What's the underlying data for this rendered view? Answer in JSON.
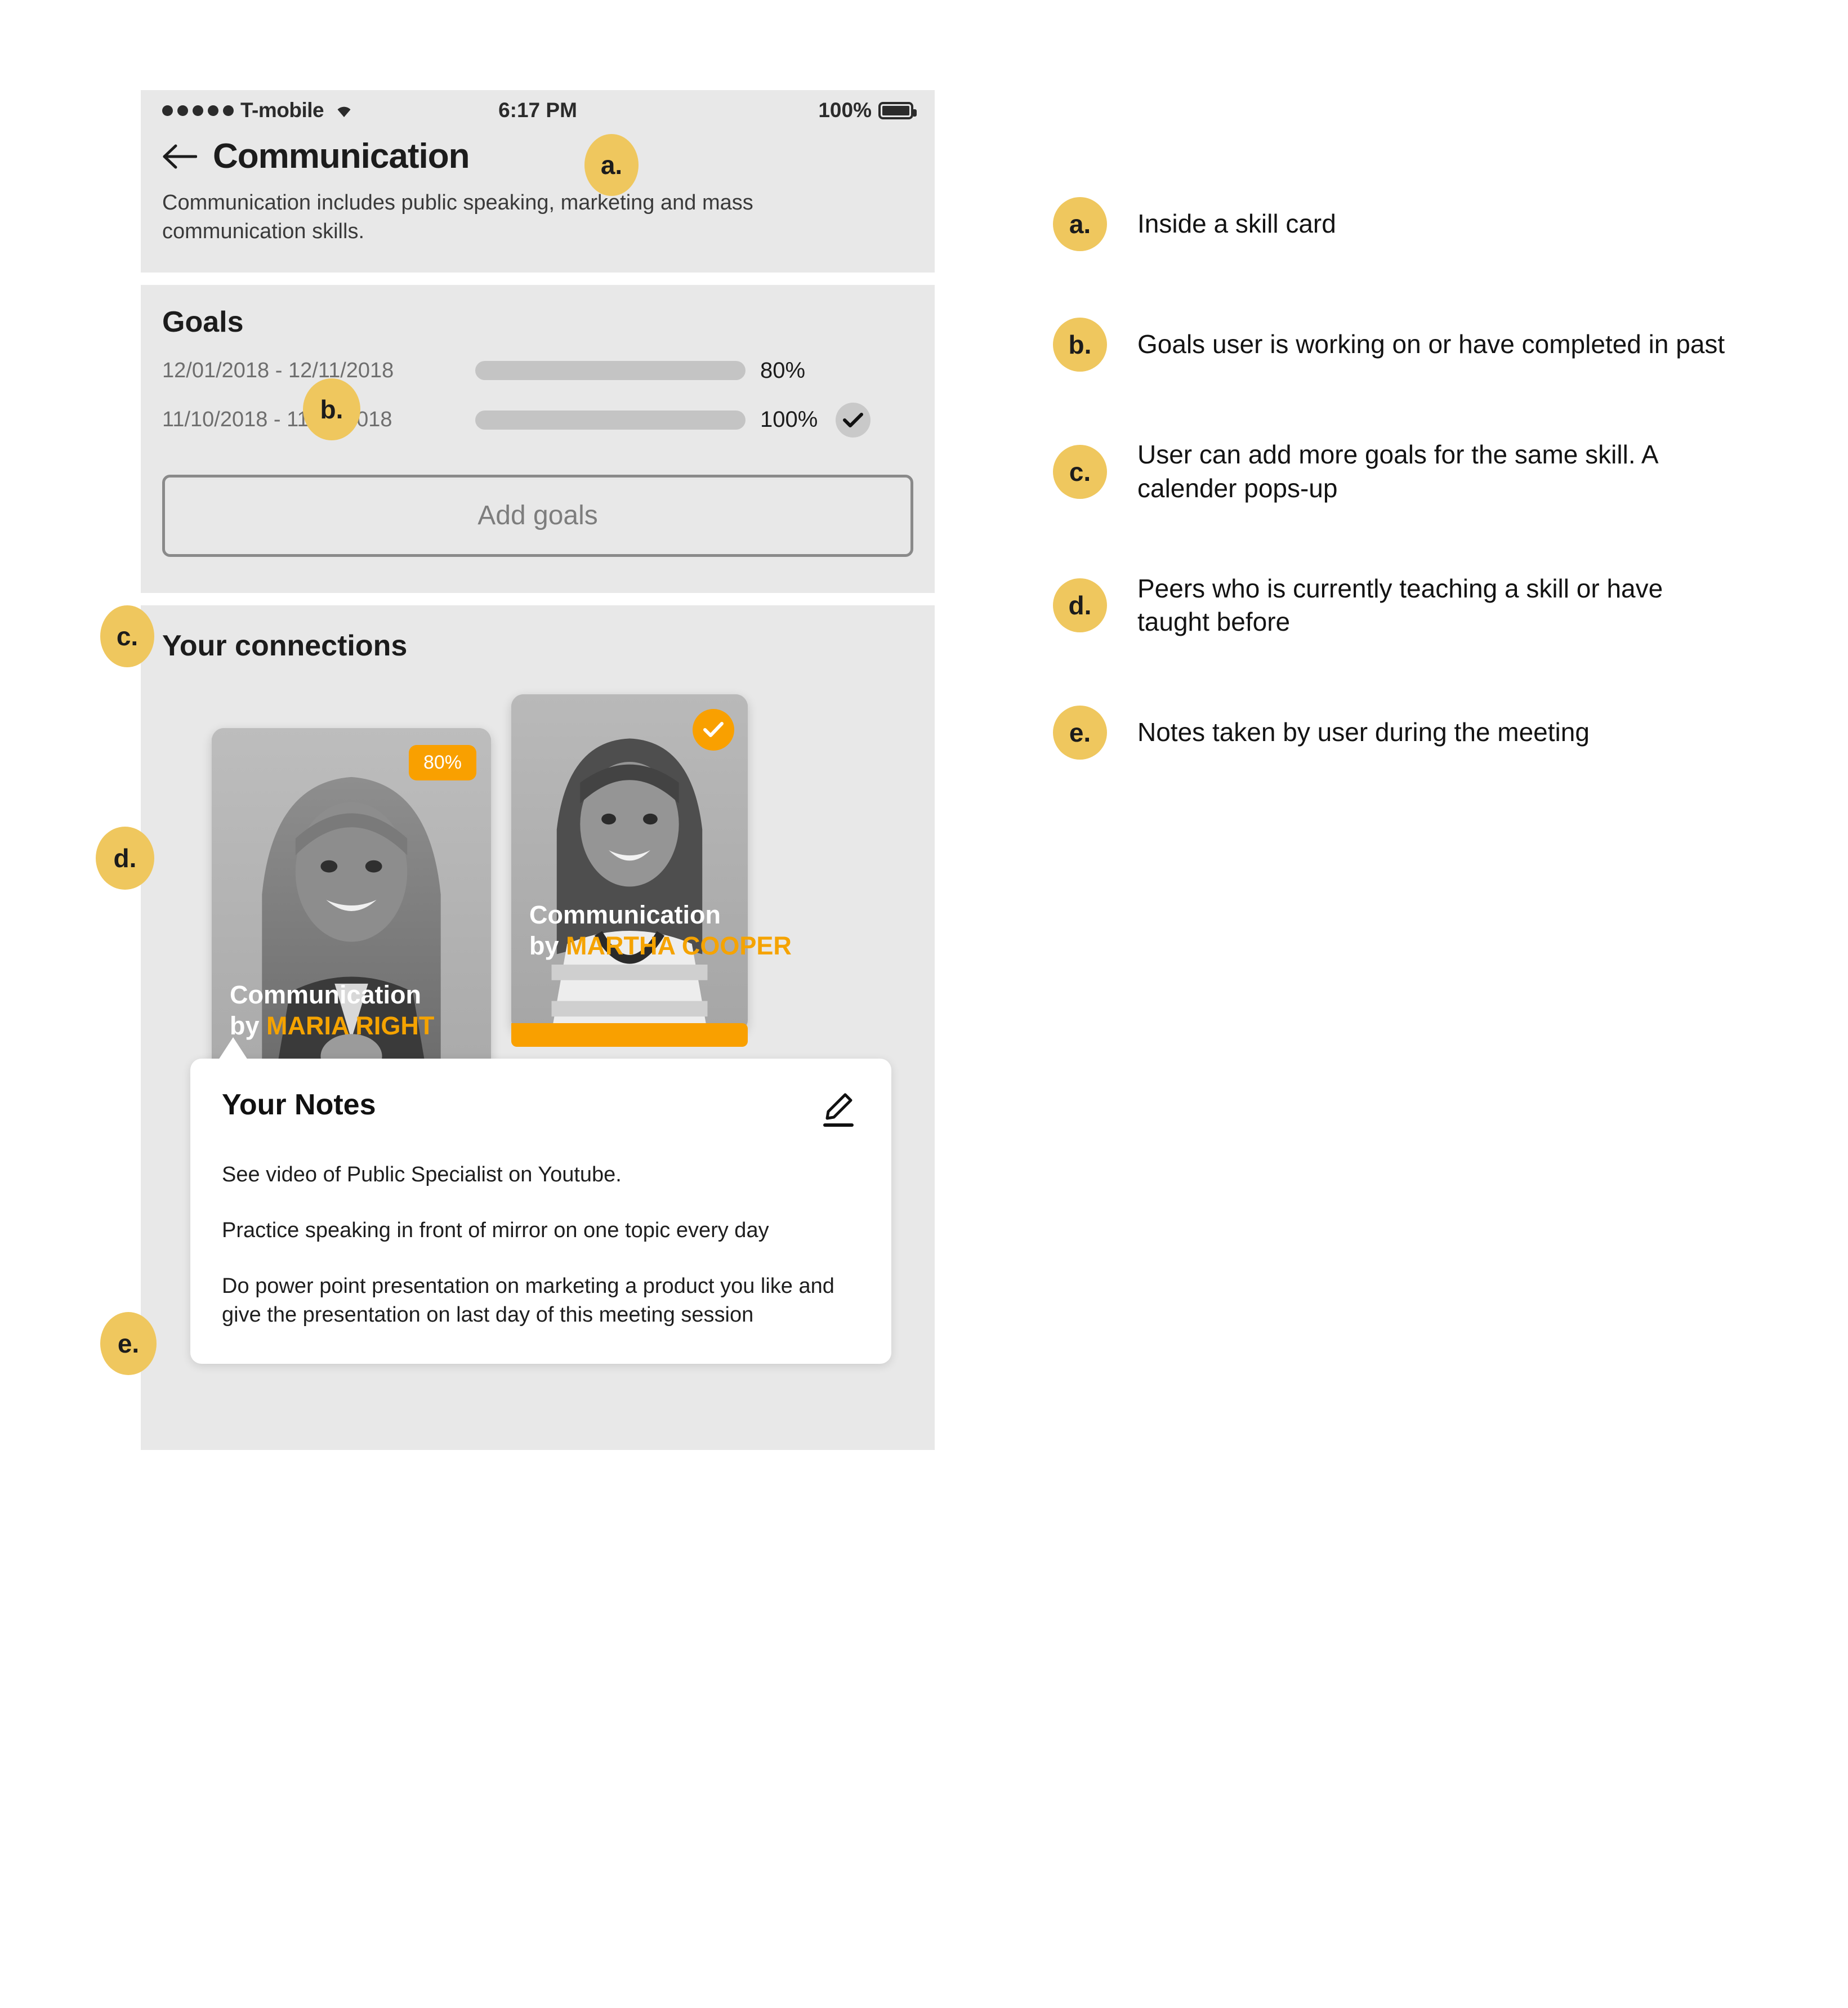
{
  "colors": {
    "panel_bg": "#e8e8e8",
    "accent_orange": "#f9a000",
    "progress_green": "#1f9e0a",
    "callout_yellow": "#efc75e",
    "track_gray": "#c4c4c4"
  },
  "status_bar": {
    "signal_dots": 5,
    "carrier": "T-mobile",
    "wifi_icon": "wifi-icon",
    "time": "6:17 PM",
    "battery_percent": "100%",
    "battery_icon": "battery-full-icon"
  },
  "header": {
    "back_icon": "back-arrow-icon",
    "title": "Communication",
    "description": "Communication includes public speaking, marketing and mass communication skills."
  },
  "goals": {
    "title": "Goals",
    "rows": [
      {
        "date_range": "12/01/2018 - 12/11/2018",
        "percent_label": "80%",
        "percent_value": 80,
        "completed": false
      },
      {
        "date_range": "11/10/2018 - 11/17/2018",
        "percent_label": "100%",
        "percent_value": 100,
        "completed": true,
        "check_icon": "check-icon"
      }
    ],
    "add_button_label": "Add goals"
  },
  "connections": {
    "title": "Your connections",
    "cards": [
      {
        "skill": "Communication",
        "by_prefix": "by ",
        "teacher": "MARIA RIGHT",
        "badge_type": "percent",
        "badge_label": "80%",
        "progress_value": 80
      },
      {
        "skill": "Communication",
        "by_prefix": "by ",
        "teacher": "MARTHA COOPER",
        "badge_type": "check",
        "badge_icon": "check-circle-icon",
        "progress_value": 100
      }
    ]
  },
  "notes": {
    "title": "Your Notes",
    "edit_icon": "pencil-edit-icon",
    "paragraphs": [
      "See video of Public Specialist on Youtube.",
      "Practice speaking in front of mirror on one topic every day",
      "Do power point presentation on marketing a product you like and give the presentation on last day of this meeting session"
    ]
  },
  "callouts": {
    "a": "a.",
    "b": "b.",
    "c": "c.",
    "d": "d.",
    "e": "e."
  },
  "legend": {
    "items": [
      {
        "key": "a.",
        "text": "Inside a skill card"
      },
      {
        "key": "b.",
        "text": "Goals user is working on or have completed in past"
      },
      {
        "key": "c.",
        "text": "User can add more goals for the same skill. A calender pops-up"
      },
      {
        "key": "d.",
        "text": "Peers who is currently teaching a skill or have taught before"
      },
      {
        "key": "e.",
        "text": "Notes taken by user during the meeting"
      }
    ]
  }
}
